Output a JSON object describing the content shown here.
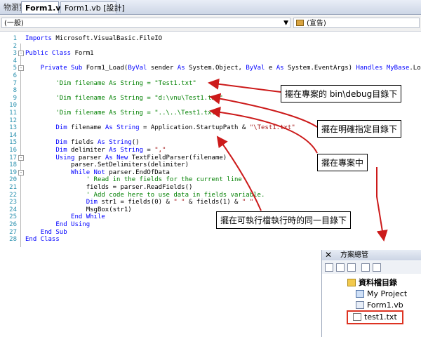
{
  "tabs": {
    "cut": "物瀏覽器",
    "active": "Form1.vb",
    "design": "Form1.vb [設計]"
  },
  "dropdowns": {
    "left": "(一般)",
    "right": "(宣告)"
  },
  "code_lines": [
    {
      "n": "1",
      "fold": "",
      "parts": [
        {
          "c": "kw",
          "t": "Imports "
        },
        {
          "c": "",
          "t": "Microsoft.VisualBasic.FileIO"
        }
      ]
    },
    {
      "n": "2",
      "fold": "",
      "parts": []
    },
    {
      "n": "3",
      "fold": "-",
      "parts": [
        {
          "c": "kw",
          "t": "Public Class "
        },
        {
          "c": "",
          "t": "Form1"
        }
      ]
    },
    {
      "n": "4",
      "fold": "",
      "parts": []
    },
    {
      "n": "5",
      "fold": "-",
      "parts": [
        {
          "c": "",
          "t": "    "
        },
        {
          "c": "kw",
          "t": "Private Sub "
        },
        {
          "c": "",
          "t": "Form1_Load("
        },
        {
          "c": "kw",
          "t": "ByVal "
        },
        {
          "c": "",
          "t": "sender "
        },
        {
          "c": "kw",
          "t": "As "
        },
        {
          "c": "",
          "t": "System.Object, "
        },
        {
          "c": "kw",
          "t": "ByVal "
        },
        {
          "c": "",
          "t": "e "
        },
        {
          "c": "kw",
          "t": "As "
        },
        {
          "c": "",
          "t": "System.EventArgs) "
        },
        {
          "c": "kw",
          "t": "Handles MyBase"
        },
        {
          "c": "",
          "t": ".Load"
        }
      ]
    },
    {
      "n": "6",
      "fold": "",
      "parts": []
    },
    {
      "n": "7",
      "fold": "",
      "parts": [
        {
          "c": "cm",
          "t": "        'Dim filename As String = \"Test1.txt\""
        }
      ]
    },
    {
      "n": "8",
      "fold": "",
      "parts": []
    },
    {
      "n": "9",
      "fold": "",
      "parts": [
        {
          "c": "cm",
          "t": "        'Dim filename As String = \"d:\\vnu\\Test1.txt\""
        }
      ]
    },
    {
      "n": "10",
      "fold": "",
      "parts": []
    },
    {
      "n": "11",
      "fold": "",
      "parts": [
        {
          "c": "cm",
          "t": "        'Dim filename As String = \"..\\..\\Test1.txt\""
        }
      ]
    },
    {
      "n": "12",
      "fold": "",
      "parts": []
    },
    {
      "n": "13",
      "fold": "",
      "parts": [
        {
          "c": "",
          "t": "        "
        },
        {
          "c": "kw",
          "t": "Dim "
        },
        {
          "c": "",
          "t": "filename "
        },
        {
          "c": "kw",
          "t": "As String "
        },
        {
          "c": "",
          "t": "= Application.StartupPath & "
        },
        {
          "c": "st",
          "t": "\"\\Test1.txt\""
        }
      ]
    },
    {
      "n": "14",
      "fold": "",
      "parts": []
    },
    {
      "n": "15",
      "fold": "",
      "parts": [
        {
          "c": "",
          "t": "        "
        },
        {
          "c": "kw",
          "t": "Dim "
        },
        {
          "c": "",
          "t": "fields "
        },
        {
          "c": "kw",
          "t": "As String"
        },
        {
          "c": "",
          "t": "()"
        }
      ]
    },
    {
      "n": "16",
      "fold": "",
      "parts": [
        {
          "c": "",
          "t": "        "
        },
        {
          "c": "kw",
          "t": "Dim "
        },
        {
          "c": "",
          "t": "delimiter "
        },
        {
          "c": "kw",
          "t": "As String "
        },
        {
          "c": "",
          "t": "= "
        },
        {
          "c": "st",
          "t": "\",\""
        }
      ]
    },
    {
      "n": "17",
      "fold": "-",
      "parts": [
        {
          "c": "",
          "t": "        "
        },
        {
          "c": "kw",
          "t": "Using "
        },
        {
          "c": "",
          "t": "parser "
        },
        {
          "c": "kw",
          "t": "As New "
        },
        {
          "c": "",
          "t": "TextFieldParser(filename)"
        }
      ]
    },
    {
      "n": "18",
      "fold": "",
      "parts": [
        {
          "c": "",
          "t": "            parser.SetDelimiters(delimiter)"
        }
      ]
    },
    {
      "n": "19",
      "fold": "-",
      "parts": [
        {
          "c": "",
          "t": "            "
        },
        {
          "c": "kw",
          "t": "While Not "
        },
        {
          "c": "",
          "t": "parser.EndOfData"
        }
      ]
    },
    {
      "n": "20",
      "fold": "",
      "parts": [
        {
          "c": "cm",
          "t": "                ' Read in the fields for the current line"
        }
      ]
    },
    {
      "n": "21",
      "fold": "",
      "parts": [
        {
          "c": "",
          "t": "                fields = parser.ReadFields()"
        }
      ]
    },
    {
      "n": "22",
      "fold": "",
      "parts": [
        {
          "c": "cm",
          "t": "                ' Add code here to use data in fields variable."
        }
      ]
    },
    {
      "n": "23",
      "fold": "",
      "parts": [
        {
          "c": "",
          "t": "                "
        },
        {
          "c": "kw",
          "t": "Dim "
        },
        {
          "c": "",
          "t": "str1 = fields(0) & "
        },
        {
          "c": "st",
          "t": "\" \""
        },
        {
          "c": "",
          "t": " & fields(1) & "
        },
        {
          "c": "st",
          "t": "\" \""
        }
      ]
    },
    {
      "n": "24",
      "fold": "",
      "parts": [
        {
          "c": "",
          "t": "                MsgBox(str1)"
        }
      ]
    },
    {
      "n": "25",
      "fold": "",
      "parts": [
        {
          "c": "",
          "t": "            "
        },
        {
          "c": "kw",
          "t": "End While"
        }
      ]
    },
    {
      "n": "26",
      "fold": "",
      "parts": [
        {
          "c": "",
          "t": "        "
        },
        {
          "c": "kw",
          "t": "End Using"
        }
      ]
    },
    {
      "n": "27",
      "fold": "",
      "parts": [
        {
          "c": "",
          "t": "    "
        },
        {
          "c": "kw",
          "t": "End Sub"
        }
      ]
    },
    {
      "n": "28",
      "fold": "",
      "parts": [
        {
          "c": "kw",
          "t": "End Class"
        }
      ]
    }
  ],
  "annotations": {
    "bin_debug": "擺在專案的 bin\\debug目錄下",
    "explicit": "擺在明確指定目錄下",
    "project": "擺在專案中",
    "startup": "擺在可執行檔執行時的同一目錄下"
  },
  "solution_explorer": {
    "title": "方案總管",
    "close": "✕",
    "items": [
      {
        "label": "資料檔目錄",
        "icon": "folder-icon"
      },
      {
        "label": "My Project",
        "icon": "project-icon"
      },
      {
        "label": "Form1.vb",
        "icon": "form-icon"
      },
      {
        "label": "test1.txt",
        "icon": "text-file-icon"
      }
    ]
  },
  "colors": {
    "keyword": "#0000ff",
    "comment": "#008000",
    "string": "#a31515",
    "line_number": "#2b91af",
    "arrow": "#cc1a1a"
  }
}
